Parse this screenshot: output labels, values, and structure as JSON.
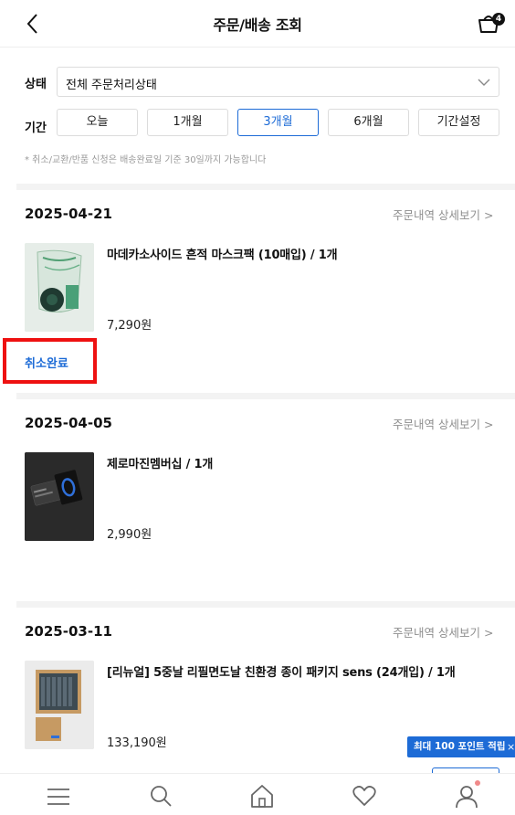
{
  "header": {
    "title": "주문/배송 조회",
    "cart_count": "4"
  },
  "filter": {
    "status_label": "상태",
    "status_value": "전체 주문처리상태",
    "period_label": "기간",
    "periods": [
      "오늘",
      "1개월",
      "3개월",
      "6개월",
      "기간설정"
    ],
    "active_period": "3개월",
    "notice": "* 취소/교환/반품 신청은 배송완료일 기준 30일까지 가능합니다"
  },
  "orders": [
    {
      "date": "2025-04-21",
      "link": "주문내역 상세보기 >",
      "product": "마데카소사이드 흔적 마스크팩 (10매입) / 1개",
      "price": "7,290원",
      "status": "취소완료"
    },
    {
      "date": "2025-04-05",
      "link": "주문내역 상세보기 >",
      "product": "제로마진멤버십 / 1개",
      "price": "2,990원"
    },
    {
      "date": "2025-03-11",
      "link": "주문내역 상세보기 >",
      "product": "[리뉴얼] 5중날 리필면도날 친환경 종이 패키지 sens (24개입) / 1개",
      "price": "133,190원"
    }
  ],
  "banner": {
    "text": "최대 100 포인트 적립",
    "close": "×"
  },
  "tabbar": [
    "menu-icon",
    "search-icon",
    "home-icon",
    "heart-icon",
    "user-icon"
  ]
}
